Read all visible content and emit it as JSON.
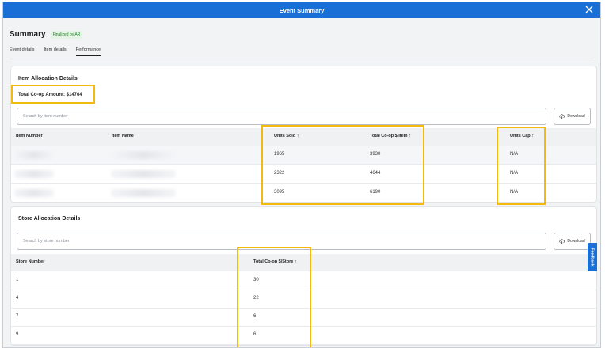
{
  "modal": {
    "title": "Event Summary"
  },
  "summary": {
    "title": "Summary",
    "badge": "Finalized by AR"
  },
  "tabs": [
    {
      "label": "Event details",
      "active": false
    },
    {
      "label": "Item details",
      "active": false
    },
    {
      "label": "Performance",
      "active": true
    }
  ],
  "item_allocation": {
    "title": "Item Allocation Details",
    "total_label": "Total Co-op Amount: $14764",
    "search_placeholder": "Search by item number",
    "download_label": "Download",
    "columns": [
      "Item Number",
      "Item Name",
      "Units Sold ↑",
      "Total Co-op $/Item ↑",
      "Units Cap ↑"
    ],
    "rows": [
      {
        "units_sold": "1965",
        "total_coop": "3930",
        "units_cap": "N/A"
      },
      {
        "units_sold": "2322",
        "total_coop": "4644",
        "units_cap": "N/A"
      },
      {
        "units_sold": "3095",
        "total_coop": "6190",
        "units_cap": "N/A"
      }
    ]
  },
  "store_allocation": {
    "title": "Store Allocation Details",
    "search_placeholder": "Search by store number",
    "download_label": "Download",
    "columns": [
      "Store Number",
      "Total Co-op $/Store ↑"
    ],
    "rows": [
      {
        "store": "1",
        "total": "30"
      },
      {
        "store": "4",
        "total": "22"
      },
      {
        "store": "7",
        "total": "6"
      },
      {
        "store": "9",
        "total": "6"
      }
    ]
  },
  "feedback": {
    "label": "Feedback"
  },
  "colors": {
    "titlebar": "#1a6fd6",
    "highlight": "#f2b90f",
    "badge_text": "#2a7d2e"
  }
}
